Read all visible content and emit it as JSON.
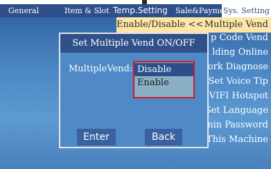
{
  "tabs": [
    {
      "label": "General"
    },
    {
      "label": "Item & Slot"
    },
    {
      "label": "Temp.Setting"
    },
    {
      "label": "Sale&Payment"
    },
    {
      "label": "Sys. Setting"
    }
  ],
  "menu": {
    "current_value": "Enable/Disable <<",
    "selected_item": "Multiple Vend",
    "items": [
      "p Code Vend",
      "lding Online",
      "ork Diagnose",
      "Set Voice Tip",
      "VIFI Hotspot",
      "Set Language",
      "nin Password",
      "This Machine"
    ]
  },
  "dialog": {
    "title": "Set Multiple Vend ON/OFF",
    "field_label": "MultipleVend:",
    "options": [
      "Disable",
      "Enable"
    ],
    "selected_option": "Disable",
    "enter_label": "Enter",
    "back_label": "Back"
  },
  "colors": {
    "tab_bar": "#2f4f8a",
    "highlight": "#fbe6a7",
    "dialog_title": "#30508a",
    "dropdown_border": "#d7152a"
  }
}
